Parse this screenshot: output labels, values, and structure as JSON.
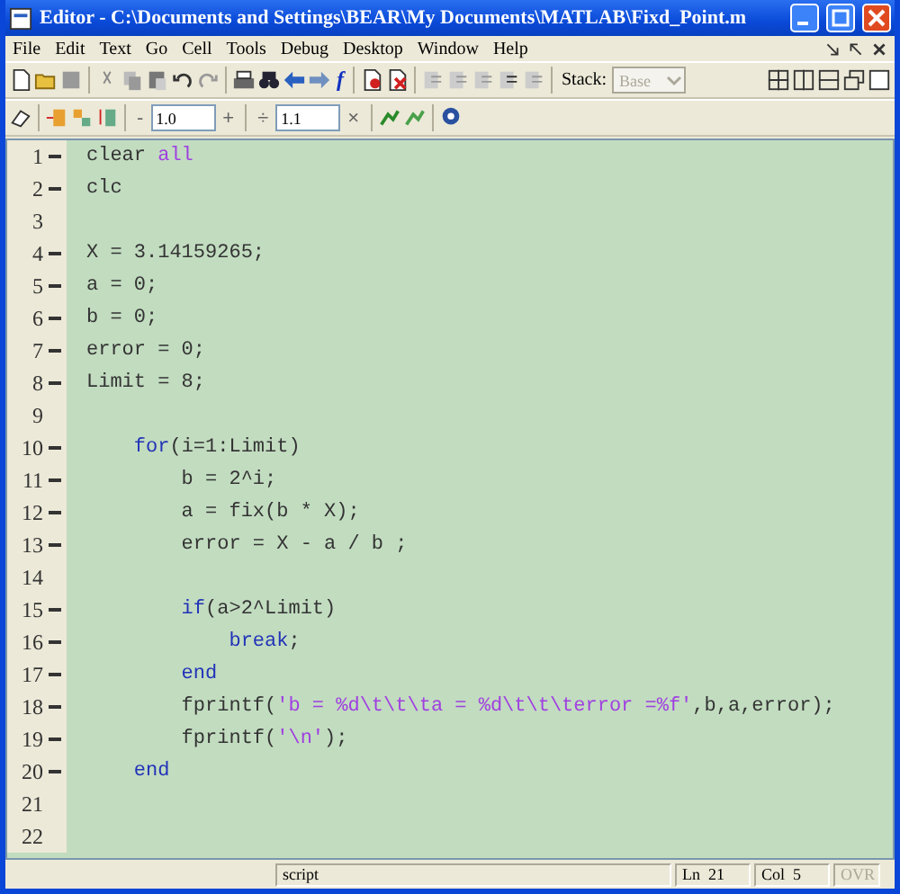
{
  "window": {
    "title": "Editor - C:\\Documents and Settings\\BEAR\\My Documents\\MATLAB\\Fixd_Point.m"
  },
  "menu": [
    "File",
    "Edit",
    "Text",
    "Go",
    "Cell",
    "Tools",
    "Debug",
    "Desktop",
    "Window",
    "Help"
  ],
  "toolbar": {
    "function_button": "f",
    "stack_label": "Stack:",
    "stack_value": "Base",
    "stack_disabled": true
  },
  "cell_toolbar": {
    "minus": "-",
    "decrement": "1.0",
    "plus": "+",
    "divide": "÷",
    "factor": "1.1",
    "times": "×"
  },
  "lines": [
    {
      "number": "1",
      "executable": true,
      "tokens": [
        {
          "kind": "code",
          "text": "clear "
        },
        {
          "kind": "string",
          "text": "all"
        }
      ]
    },
    {
      "number": "2",
      "executable": true,
      "tokens": [
        {
          "kind": "code",
          "text": "clc"
        }
      ]
    },
    {
      "number": "3",
      "executable": false
    },
    {
      "number": "4",
      "executable": true,
      "tokens": [
        {
          "kind": "code",
          "text": "X = 3.14159265;"
        }
      ]
    },
    {
      "number": "5",
      "executable": true,
      "tokens": [
        {
          "kind": "code",
          "text": "a = 0;"
        }
      ]
    },
    {
      "number": "6",
      "executable": true,
      "tokens": [
        {
          "kind": "code",
          "text": "b = 0;"
        }
      ]
    },
    {
      "number": "7",
      "executable": true,
      "tokens": [
        {
          "kind": "code",
          "text": "error = 0;"
        }
      ]
    },
    {
      "number": "8",
      "executable": true,
      "tokens": [
        {
          "kind": "code",
          "text": "Limit = 8;"
        }
      ]
    },
    {
      "number": "9",
      "executable": false
    },
    {
      "number": "10",
      "executable": true,
      "tokens": [
        {
          "kind": "keyword",
          "text": "    for"
        },
        {
          "kind": "code",
          "text": "(i=1:Limit)"
        }
      ]
    },
    {
      "number": "11",
      "executable": true,
      "tokens": [
        {
          "kind": "code",
          "text": "        b = 2^i;"
        }
      ]
    },
    {
      "number": "12",
      "executable": true,
      "tokens": [
        {
          "kind": "code",
          "text": "        a = fix(b * X);"
        }
      ]
    },
    {
      "number": "13",
      "executable": true,
      "tokens": [
        {
          "kind": "code",
          "text": "        error = X - a / b ;"
        }
      ]
    },
    {
      "number": "14",
      "executable": false
    },
    {
      "number": "15",
      "executable": true,
      "tokens": [
        {
          "kind": "keyword",
          "text": "        if"
        },
        {
          "kind": "code",
          "text": "(a>2^Limit)"
        }
      ]
    },
    {
      "number": "16",
      "executable": true,
      "tokens": [
        {
          "kind": "keyword",
          "text": "            break"
        },
        {
          "kind": "code",
          "text": ";"
        }
      ]
    },
    {
      "number": "17",
      "executable": true,
      "tokens": [
        {
          "kind": "keyword",
          "text": "        end"
        }
      ]
    },
    {
      "number": "18",
      "executable": true,
      "tokens": [
        {
          "kind": "code",
          "text": "        fprintf("
        },
        {
          "kind": "string",
          "text": "'b = %d\\t\\t\\ta = %d\\t\\t\\terror =%f'"
        },
        {
          "kind": "code",
          "text": ",b,a,error);"
        }
      ]
    },
    {
      "number": "19",
      "executable": true,
      "tokens": [
        {
          "kind": "code",
          "text": "        fprintf("
        },
        {
          "kind": "string",
          "text": "'\\n'"
        },
        {
          "kind": "code",
          "text": ");"
        }
      ]
    },
    {
      "number": "20",
      "executable": true,
      "tokens": [
        {
          "kind": "keyword",
          "text": "    end"
        }
      ]
    },
    {
      "number": "21",
      "executable": false
    },
    {
      "number": "22",
      "executable": false
    }
  ],
  "status_bar": {
    "mode": "script",
    "line": "Ln  21",
    "column": "Col  5",
    "overwrite": "OVR",
    "overwrite_on": false
  }
}
